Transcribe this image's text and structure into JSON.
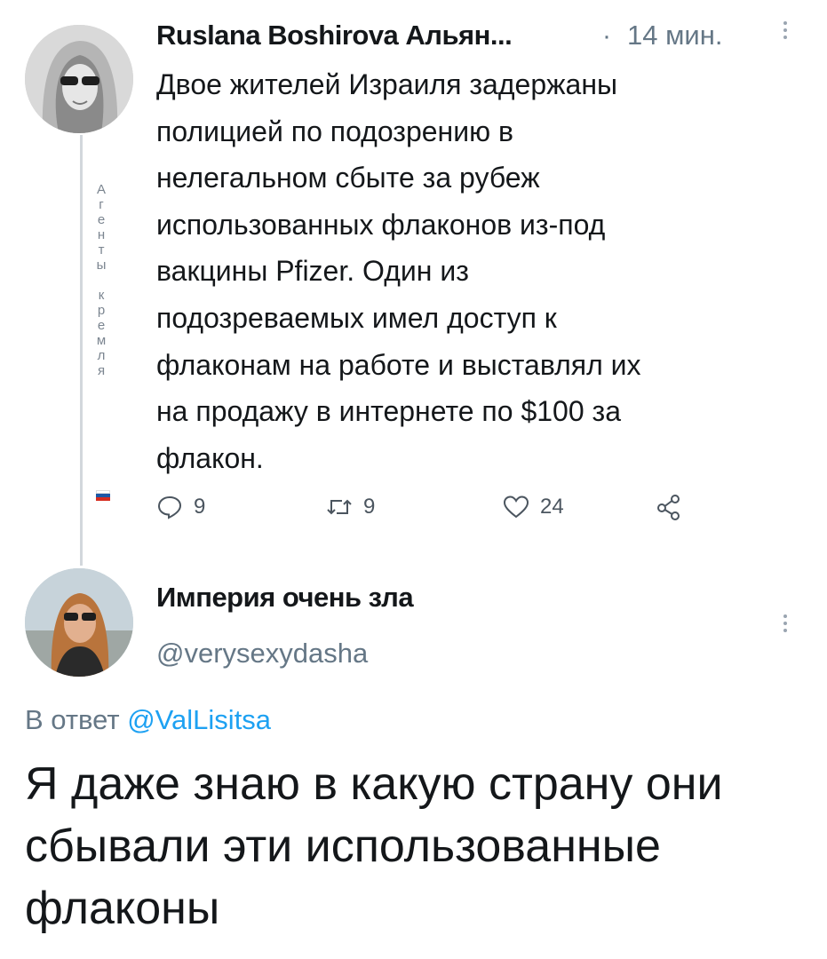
{
  "tweet1": {
    "author": "Ruslana Boshirova Альян...",
    "separator": "·",
    "time": "14 мин.",
    "text": "Двое жителей Израиля задержаны\nполицией по подозрению в\nнелегальном сбыте за рубеж\nиспользованных флаконов из-под\nвакцины Pfizer. Один из\nподозреваемых имел доступ к\nфлаконам на работе и выставлял их\nна продажу в интернете по $100 за\nфлакон.",
    "side_label_letters": [
      "А",
      "г",
      "е",
      "н",
      "т",
      "ы",
      "",
      "к",
      "р",
      "е",
      "м",
      "л",
      "я"
    ],
    "actions": {
      "replies": "9",
      "retweets": "9",
      "likes": "24"
    }
  },
  "tweet2": {
    "author": "Империя очень зла",
    "handle": "@verysexydasha",
    "reply_prefix": "В ответ ",
    "reply_mention": "@ValLisitsa",
    "text": "Я даже знаю в какую страну они\nсбывали эти использованные\nфлаконы"
  },
  "icons": [
    "reply-icon",
    "retweet-icon",
    "like-icon",
    "share-icon",
    "more-menu-icon",
    "russian-flag-icon"
  ],
  "colors": {
    "text": "#14171a",
    "muted": "#657786",
    "link": "#1da1f2",
    "thread_line": "#d2d7dc"
  }
}
